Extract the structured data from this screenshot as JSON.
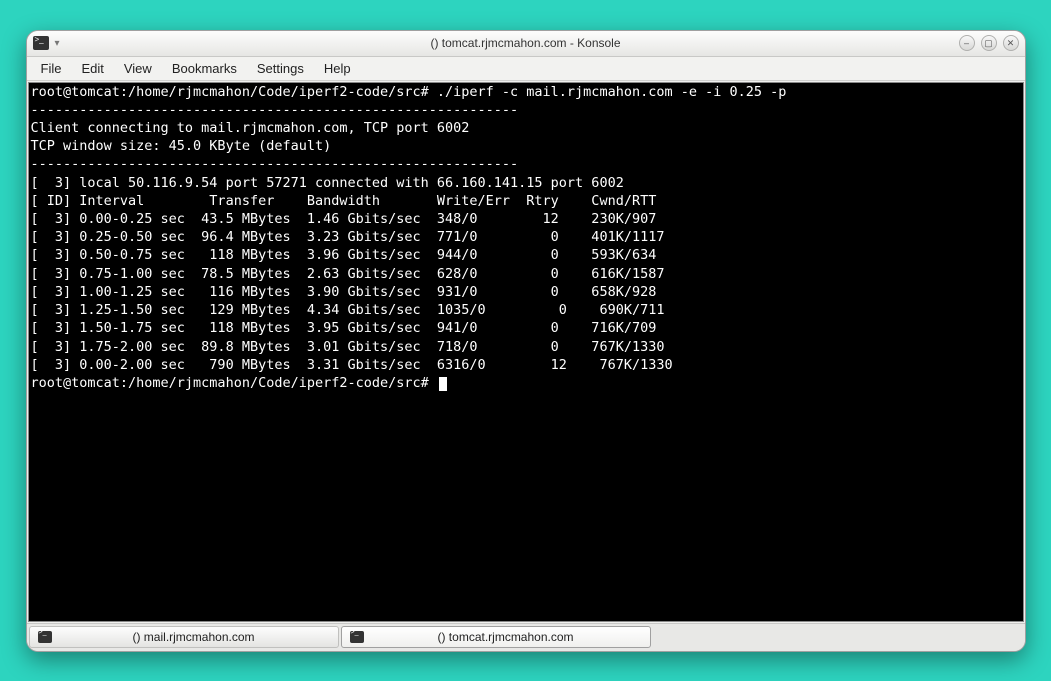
{
  "window": {
    "title": "() tomcat.rjmcmahon.com - Konsole"
  },
  "menu": {
    "items": [
      "File",
      "Edit",
      "View",
      "Bookmarks",
      "Settings",
      "Help"
    ]
  },
  "terminal": {
    "prompt1": "root@tomcat:/home/rjmcmahon/Code/iperf2-code/src# ./iperf -c mail.rjmcmahon.com -e -i 0.25 -p ",
    "sep1": "------------------------------------------------------------",
    "conn1": "Client connecting to mail.rjmcmahon.com, TCP port 6002",
    "conn2": "TCP window size: 45.0 KByte (default)",
    "sep2": "------------------------------------------------------------",
    "local": "[  3] local 50.116.9.54 port 57271 connected with 66.160.141.15 port 6002",
    "header": "[ ID] Interval        Transfer    Bandwidth       Write/Err  Rtry    Cwnd/RTT",
    "rows": [
      "[  3] 0.00-0.25 sec  43.5 MBytes  1.46 Gbits/sec  348/0        12    230K/907",
      "[  3] 0.25-0.50 sec  96.4 MBytes  3.23 Gbits/sec  771/0         0    401K/1117",
      "[  3] 0.50-0.75 sec   118 MBytes  3.96 Gbits/sec  944/0         0    593K/634",
      "[  3] 0.75-1.00 sec  78.5 MBytes  2.63 Gbits/sec  628/0         0    616K/1587",
      "[  3] 1.00-1.25 sec   116 MBytes  3.90 Gbits/sec  931/0         0    658K/928",
      "[  3] 1.25-1.50 sec   129 MBytes  4.34 Gbits/sec  1035/0         0    690K/711",
      "[  3] 1.50-1.75 sec   118 MBytes  3.95 Gbits/sec  941/0         0    716K/709",
      "[  3] 1.75-2.00 sec  89.8 MBytes  3.01 Gbits/sec  718/0         0    767K/1330",
      "[  3] 0.00-2.00 sec   790 MBytes  3.31 Gbits/sec  6316/0        12    767K/1330"
    ],
    "prompt2": "root@tomcat:/home/rjmcmahon/Code/iperf2-code/src# "
  },
  "tabs": [
    {
      "label": "() mail.rjmcmahon.com",
      "active": false
    },
    {
      "label": "() tomcat.rjmcmahon.com",
      "active": true
    }
  ]
}
